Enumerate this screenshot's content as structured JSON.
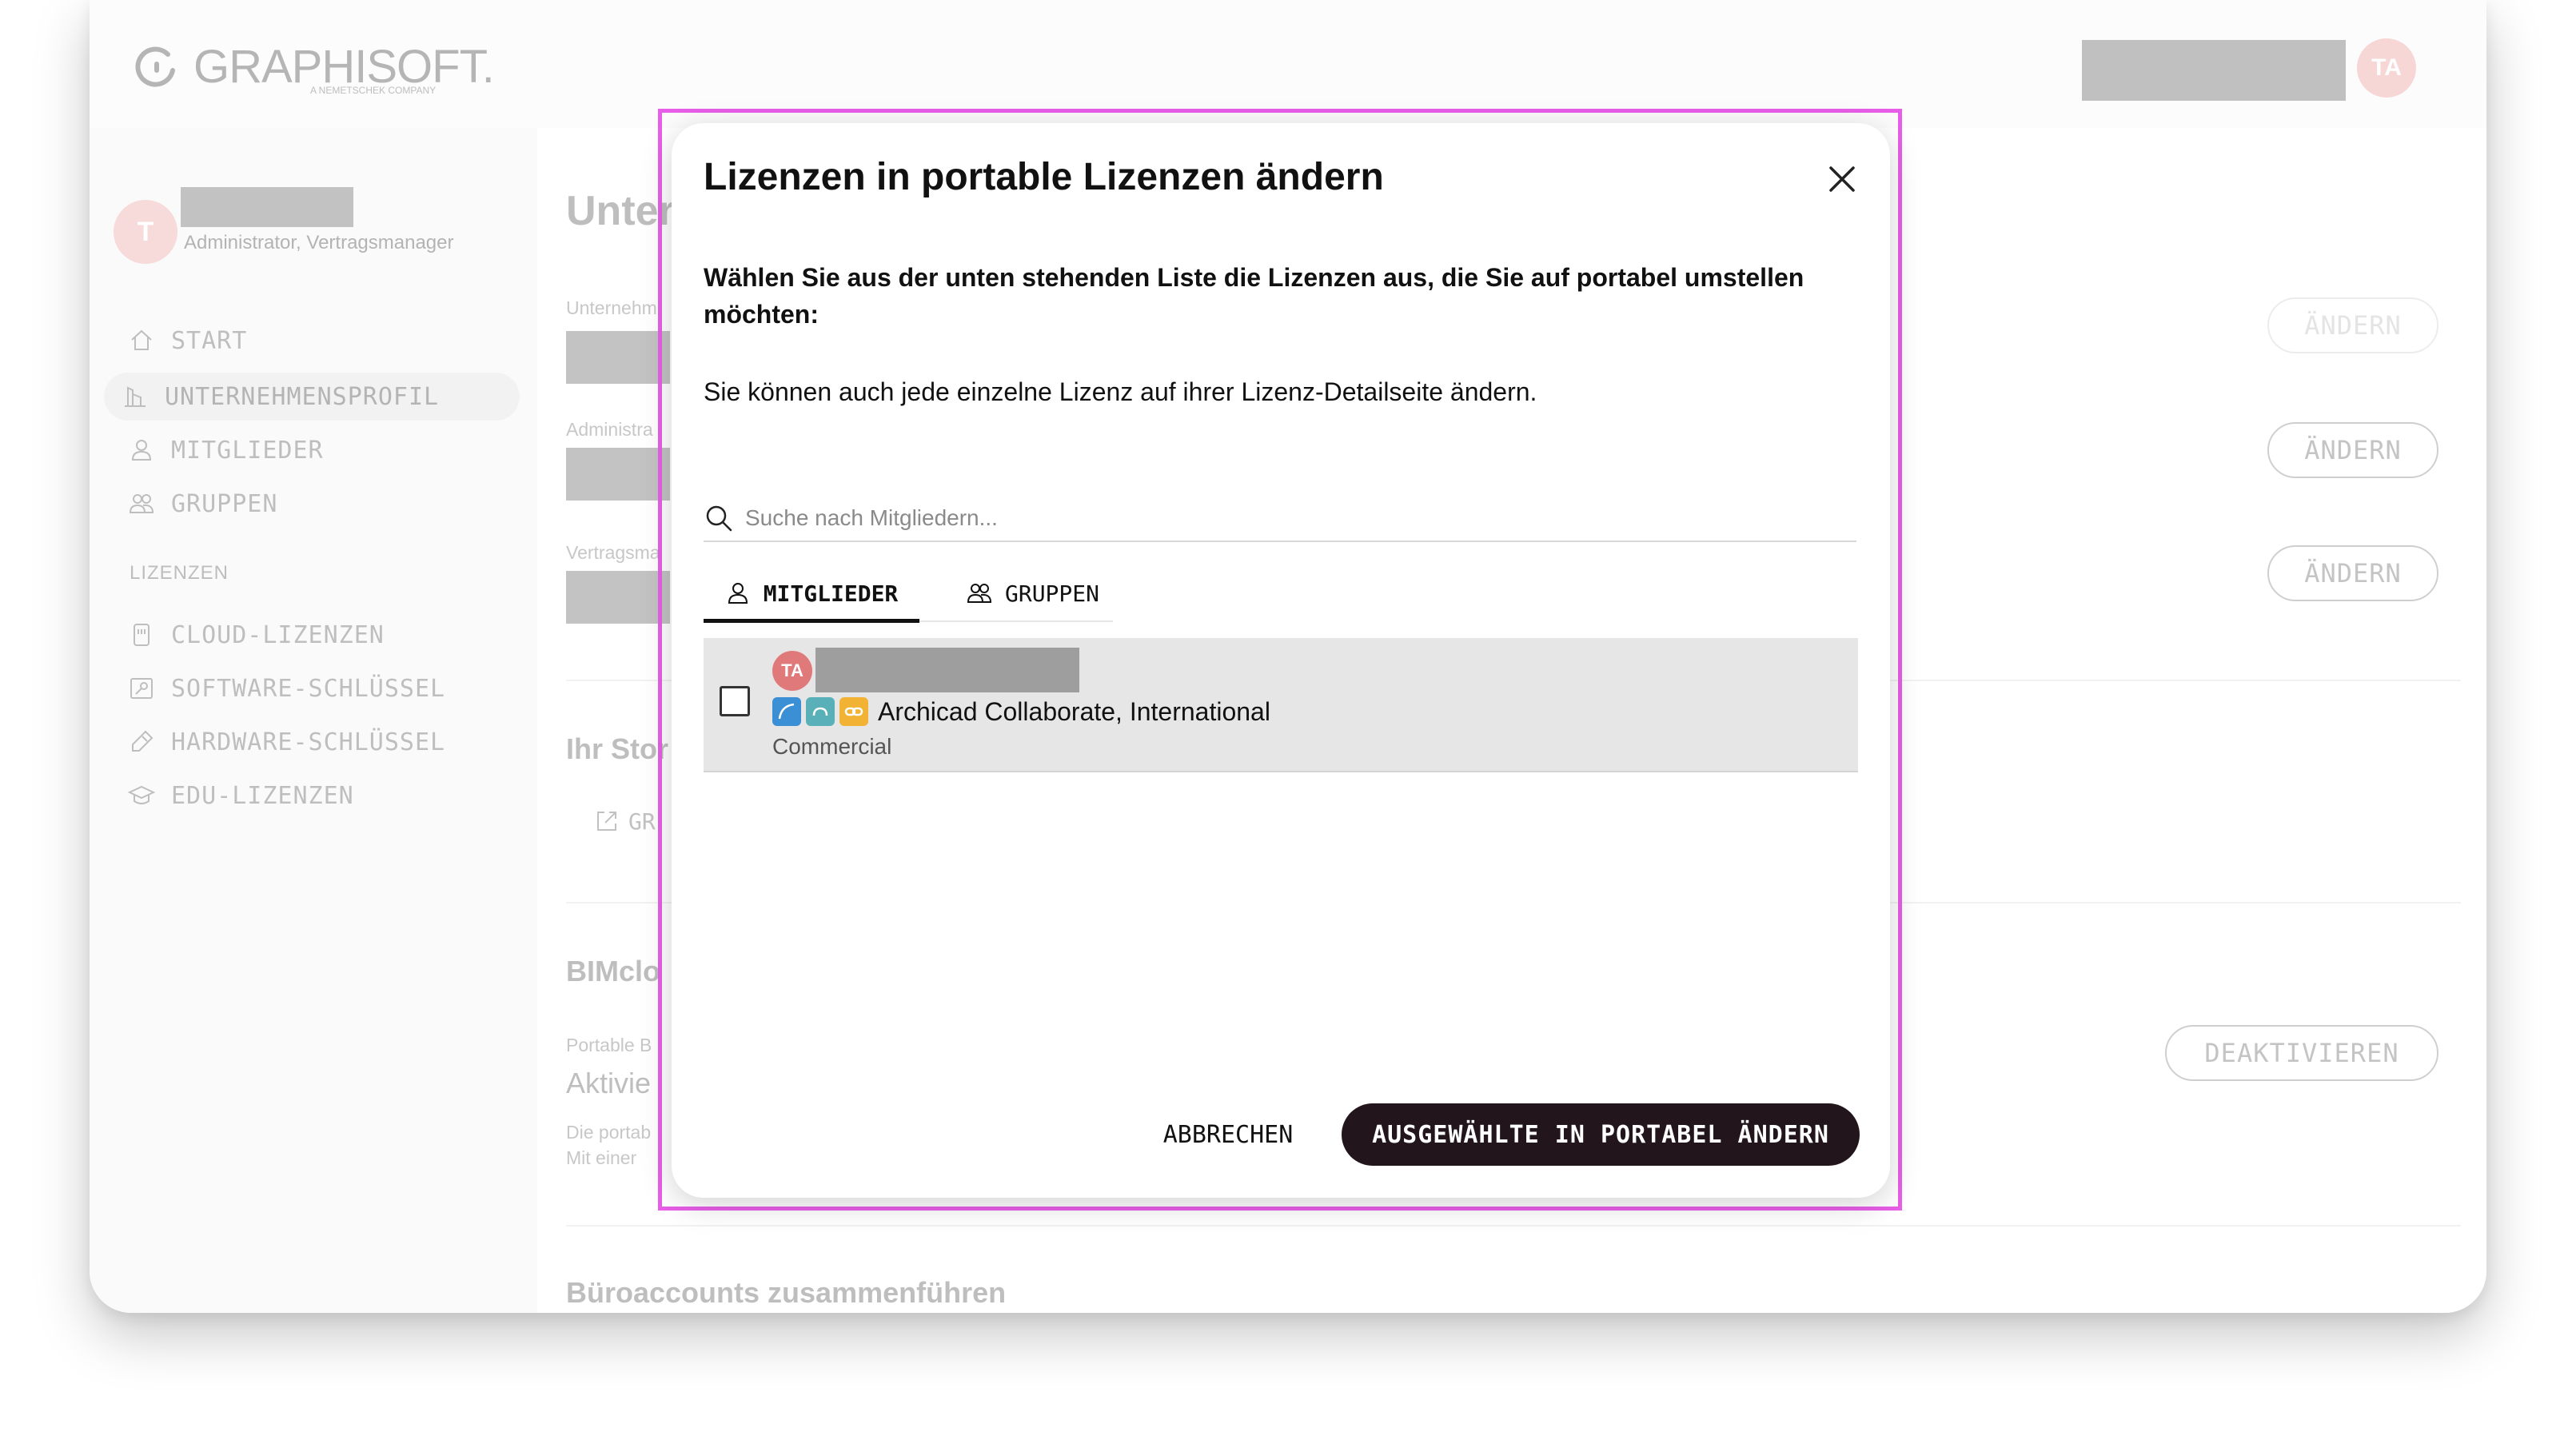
{
  "header": {
    "logo_text": "GRAPHISOFT.",
    "logo_subtext": "A NEMETSCHEK COMPANY",
    "user_initials": "TA"
  },
  "sidebar": {
    "user_initial": "T",
    "user_role": "Administrator, Vertragsmanager",
    "nav_items": [
      {
        "label": "START",
        "icon": "home-icon"
      },
      {
        "label": "UNTERNEHMENSPROFIL",
        "icon": "building-icon",
        "active": true
      },
      {
        "label": "MITGLIEDER",
        "icon": "person-icon"
      },
      {
        "label": "GRUPPEN",
        "icon": "people-icon"
      }
    ],
    "section_label": "LIZENZEN",
    "license_items": [
      {
        "label": "CLOUD-LIZENZEN",
        "icon": "cloud-license-icon"
      },
      {
        "label": "SOFTWARE-SCHLÜSSEL",
        "icon": "software-key-icon"
      },
      {
        "label": "HARDWARE-SCHLÜSSEL",
        "icon": "hardware-key-icon"
      },
      {
        "label": "EDU-LIZENZEN",
        "icon": "graduation-cap-icon"
      }
    ]
  },
  "content": {
    "title": "Unter",
    "label_company": "Unternehm",
    "label_admin": "Administra",
    "label_contract": "Vertragsma",
    "section_store": "Ihr Stor",
    "store_link": "GR",
    "section_bimcloud": "BIMclo",
    "label_portable": "Portable B",
    "status_value": "Aktivie",
    "desc_line1": "Die portab",
    "desc_line2": "Mit einer ",
    "section_merge": "Büroaccounts zusammenführen",
    "edit_label": "ÄNDERN",
    "deactivate_label": "DEAKTIVIEREN"
  },
  "modal": {
    "title": "Lizenzen in portable Lizenzen ändern",
    "instruction": "Wählen Sie aus der unten stehenden Liste die Lizenzen aus, die Sie auf portabel umstellen möchten:",
    "hint": "Sie können auch jede einzelne Lizenz auf ihrer Lizenz-Detailseite ändern.",
    "search_placeholder": "Suche nach Mitgliedern...",
    "tabs": [
      {
        "label": "MITGLIEDER",
        "active": true
      },
      {
        "label": "GRUPPEN",
        "active": false
      }
    ],
    "rows": [
      {
        "initials": "TA",
        "product": "Archicad Collaborate, International",
        "license_type": "Commercial",
        "checked": false,
        "product_icons": [
          "archicad-icon",
          "bimcloud-icon",
          "link-icon"
        ]
      }
    ],
    "cancel_label": "ABBRECHEN",
    "confirm_label": "AUSGEWÄHLTE IN PORTABEL ÄNDERN"
  },
  "colors": {
    "accent_dark": "#22161c",
    "avatar_pink": "#e07a7a",
    "highlight_outline": "#e85ee8",
    "archicad_blue": "#3b8fd4",
    "bimcloud_teal": "#5ab0b8",
    "link_orange": "#f2b233"
  }
}
